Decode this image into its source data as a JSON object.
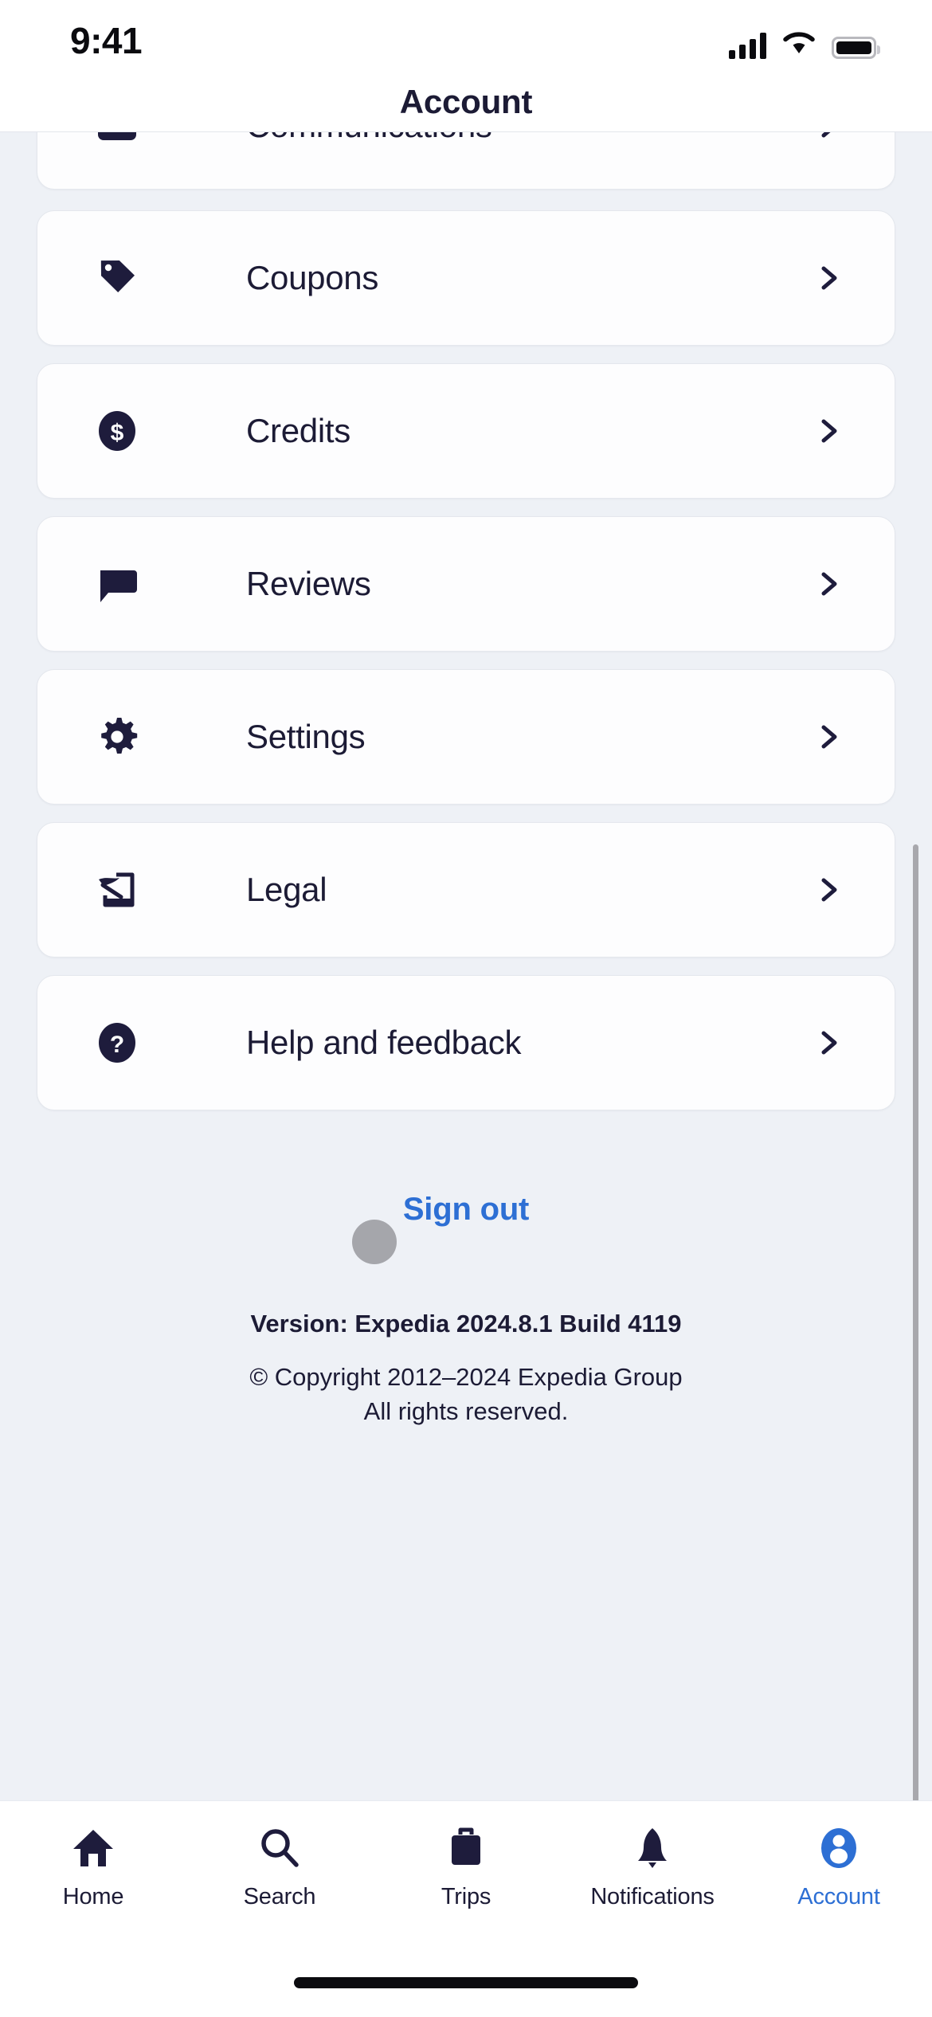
{
  "status_bar": {
    "time": "9:41",
    "cellular_icon": "signal-bars-icon",
    "wifi_icon": "wifi-icon",
    "battery_icon": "battery-full-icon"
  },
  "header": {
    "title": "Account"
  },
  "colors": {
    "page_background": "#eef1f6",
    "card_background": "#fdfdfe",
    "card_border": "#e4e7ed",
    "text_primary": "#1c1b35",
    "accent_blue": "#2d6fd4",
    "touch_indicator": "rgba(120,120,124,0.62)"
  },
  "menu": {
    "rows": [
      {
        "label": "Communications",
        "icon": "envelope-icon",
        "chevron": "chevron-right-icon",
        "clipped_top": true
      },
      {
        "label": "Coupons",
        "icon": "tag-icon",
        "chevron": "chevron-right-icon"
      },
      {
        "label": "Credits",
        "icon": "dollar-circle-icon",
        "chevron": "chevron-right-icon"
      },
      {
        "label": "Reviews",
        "icon": "speech-bubble-icon",
        "chevron": "chevron-right-icon"
      },
      {
        "label": "Settings",
        "icon": "gear-icon",
        "chevron": "chevron-right-icon"
      },
      {
        "label": "Legal",
        "icon": "quill-document-icon",
        "chevron": "chevron-right-icon"
      },
      {
        "label": "Help and feedback",
        "icon": "question-circle-icon",
        "chevron": "chevron-right-icon"
      }
    ]
  },
  "sign_out": {
    "label": "Sign out"
  },
  "footer": {
    "version": "Version: Expedia 2024.8.1 Build 4119",
    "copyright_line1": "© Copyright 2012–2024 Expedia Group",
    "copyright_line2": "All rights reserved."
  },
  "tab_bar": {
    "items": [
      {
        "label": "Home",
        "icon": "house-icon",
        "active": false
      },
      {
        "label": "Search",
        "icon": "search-icon",
        "active": false
      },
      {
        "label": "Trips",
        "icon": "suitcase-icon",
        "active": false
      },
      {
        "label": "Notifications",
        "icon": "bell-icon",
        "active": false
      },
      {
        "label": "Account",
        "icon": "person-circle-icon",
        "active": true
      }
    ]
  },
  "scrollbar": {
    "visible": true,
    "position_hint": "right-edge-middle"
  }
}
